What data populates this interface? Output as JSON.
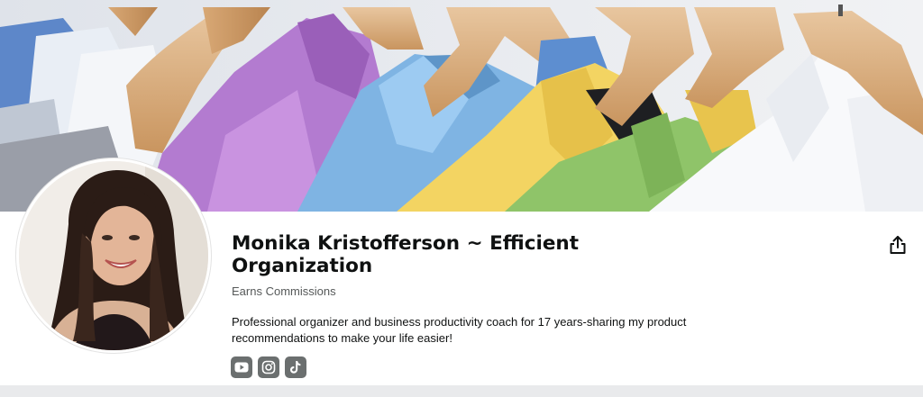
{
  "profile": {
    "name": "Monika Kristofferson ~ Efficient Organization",
    "badge": "Earns Commissions",
    "bio": "Professional organizer and business productivity coach for 17 years-sharing my product recommendations to make your life easier!"
  },
  "socials": [
    {
      "icon": "youtube-icon"
    },
    {
      "icon": "instagram-icon"
    },
    {
      "icon": "tiktok-icon"
    }
  ],
  "share": {
    "icon": "share-icon"
  },
  "colors": {
    "text_primary": "#0f1111",
    "text_secondary": "#565959",
    "social_icon_bg": "#6b6f6f",
    "page_background": "#ffffff",
    "bottom_strip": "#e9eaec"
  }
}
